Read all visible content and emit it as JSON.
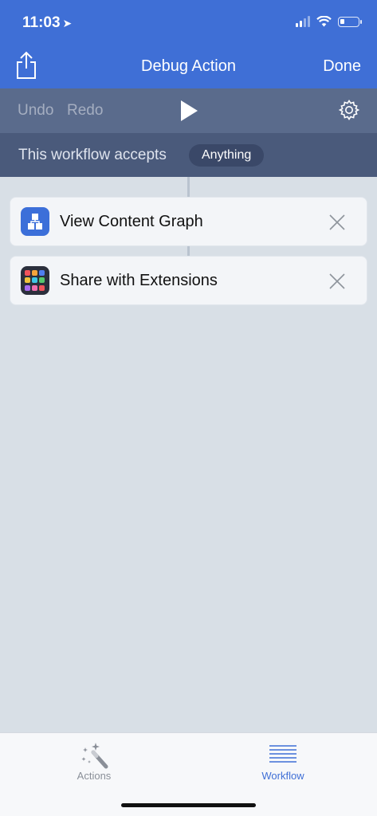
{
  "status": {
    "time": "11:03"
  },
  "nav": {
    "title": "Debug Action",
    "done_label": "Done"
  },
  "toolbar": {
    "undo_label": "Undo",
    "redo_label": "Redo"
  },
  "accepts": {
    "label": "This workflow accepts",
    "value": "Anything"
  },
  "actions": [
    {
      "label": "View Content Graph",
      "icon": "content-graph-icon"
    },
    {
      "label": "Share with Extensions",
      "icon": "extensions-icon"
    }
  ],
  "tabs": [
    {
      "label": "Actions",
      "icon": "magic-wand-icon",
      "selected": false
    },
    {
      "label": "Workflow",
      "icon": "list-icon",
      "selected": true
    }
  ],
  "colors": {
    "accent": "#3f6fd6",
    "toolbar": "#5a6b8c",
    "accepts_bar": "#4a5a7b",
    "canvas": "#d8dfe6"
  }
}
